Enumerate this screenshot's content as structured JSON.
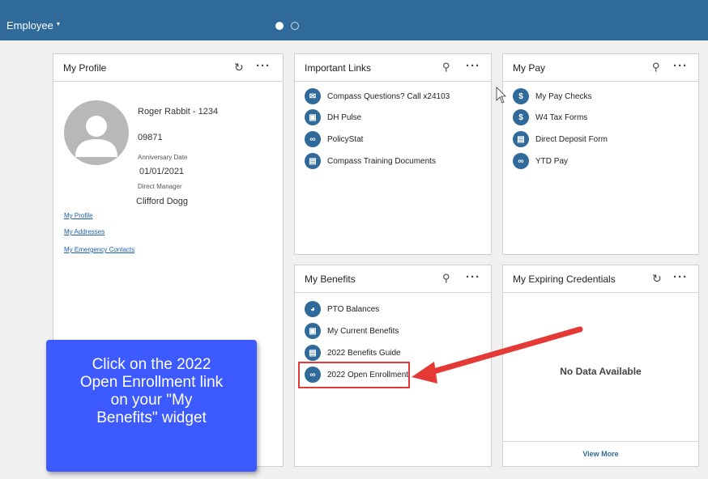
{
  "topbar": {
    "role_label": "Employee",
    "role_caret": "▾"
  },
  "my_profile": {
    "title": "My Profile",
    "name": "Roger Rabbit - 1234",
    "employee_no": "09871",
    "anniversary_label": "Anniversary Date",
    "anniversary_date": "01/01/2021",
    "manager_label": "Direct Manager",
    "manager_name": "Clifford Dogg",
    "links": [
      "My Profile",
      "My Addresses",
      "My Emergency Contacts"
    ]
  },
  "important_links": {
    "title": "Important Links",
    "items": [
      {
        "label": "Compass Questions? Call x24103",
        "icon": "envelope-icon"
      },
      {
        "label": "DH Pulse",
        "icon": "image-icon"
      },
      {
        "label": "PolicyStat",
        "icon": "link-icon"
      },
      {
        "label": "Compass Training Documents",
        "icon": "pdf-icon"
      }
    ]
  },
  "my_pay": {
    "title": "My Pay",
    "items": [
      {
        "label": "My Pay Checks",
        "icon": "dollar-icon"
      },
      {
        "label": "W4 Tax Forms",
        "icon": "dollar-icon"
      },
      {
        "label": "Direct Deposit Form",
        "icon": "pdf-icon"
      },
      {
        "label": "YTD Pay",
        "icon": "link-icon"
      }
    ]
  },
  "my_benefits": {
    "title": "My Benefits",
    "items": [
      {
        "label": "PTO Balances",
        "icon": "pie-icon"
      },
      {
        "label": "My Current Benefits",
        "icon": "image-icon"
      },
      {
        "label": "2022 Benefits Guide",
        "icon": "pdf-icon"
      },
      {
        "label": "2022 Open Enrollment",
        "icon": "link-icon"
      }
    ]
  },
  "my_expiring_credentials": {
    "title": "My Expiring Credentials",
    "empty_text": "No Data Available",
    "view_more": "View More"
  },
  "callout": {
    "lines": [
      "Click on the 2022",
      "Open Enrollment link",
      "on your \"My",
      "Benefits\" widget"
    ]
  },
  "colors": {
    "topbar": "#2f6a9a",
    "callout": "#3d5afe",
    "highlight": "#e53935"
  }
}
